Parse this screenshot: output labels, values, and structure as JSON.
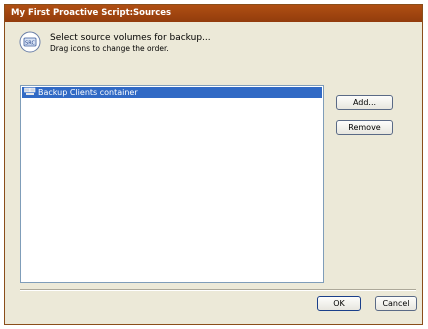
{
  "window": {
    "title": "My First Proactive Script:Sources"
  },
  "header": {
    "title": "Select source volumes for backup...",
    "subtitle": "Drag icons to change the order."
  },
  "sources": {
    "items": [
      {
        "label": "Backup Clients container",
        "selected": true
      }
    ]
  },
  "buttons": {
    "add": "Add...",
    "remove": "Remove",
    "ok": "OK",
    "cancel": "Cancel"
  },
  "colors": {
    "titlebar": "#a0460f",
    "selection": "#316ac5",
    "dialog_bg": "#ece9d8"
  }
}
